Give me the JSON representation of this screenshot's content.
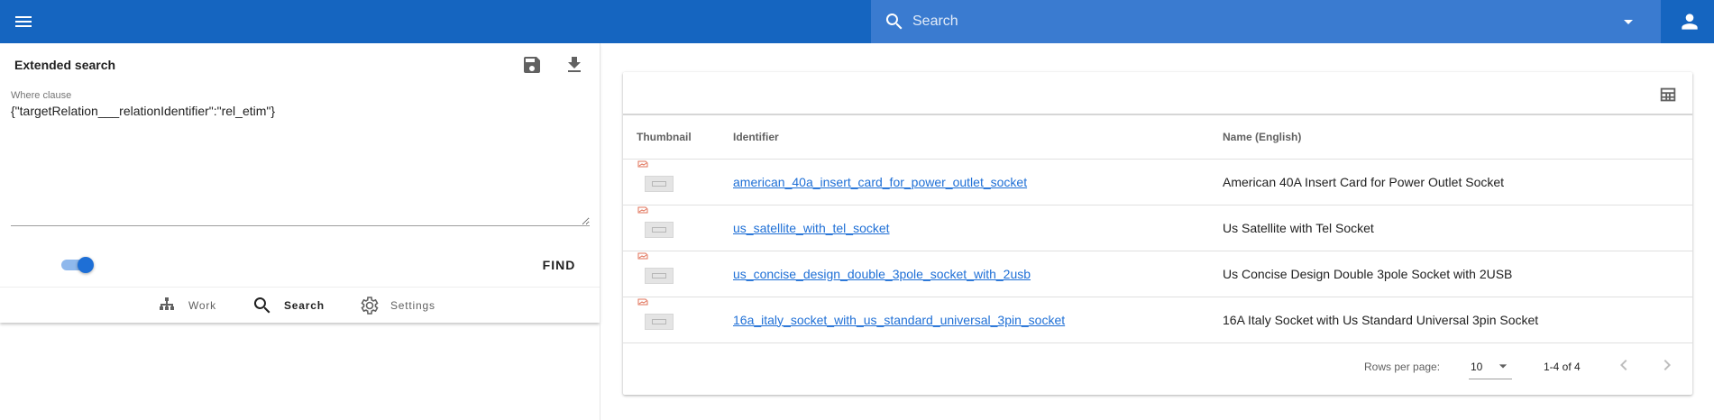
{
  "colors": {
    "appbar": "#1565c0",
    "search_bg": "#3a7bd0",
    "link": "#1e6fd6",
    "toggle_on": "#1e6fd6"
  },
  "appbar": {
    "menu_icon": "hamburger-menu-icon",
    "search": {
      "placeholder": "Search",
      "icon": "search-icon",
      "dropdown_icon": "caret-down-icon"
    },
    "account_icon": "account-icon"
  },
  "extended_search": {
    "title": "Extended search",
    "save_icon": "save-icon",
    "download_icon": "download-icon",
    "where_label": "Where clause",
    "where_value": "{\"targetRelation___relationIdentifier\":\"rel_etim\"}",
    "toggle_on": true,
    "find_label": "FIND"
  },
  "bottom_nav": [
    {
      "label": "Work",
      "icon": "sitemap-icon",
      "active": false
    },
    {
      "label": "Search",
      "icon": "search-icon",
      "active": true
    },
    {
      "label": "Settings",
      "icon": "gear-icon",
      "active": false
    }
  ],
  "results": {
    "columns_icon": "table-columns-icon",
    "headers": [
      "Thumbnail",
      "Identifier",
      "Name (English)"
    ],
    "rows": [
      {
        "identifier": "american_40a_insert_card_for_power_outlet_socket",
        "name": "American 40A Insert Card for Power Outlet Socket"
      },
      {
        "identifier": "us_satellite_with_tel_socket",
        "name": "Us Satellite with Tel Socket"
      },
      {
        "identifier": "us_concise_design_double_3pole_socket_with_2usb",
        "name": "Us Concise Design Double 3pole Socket with 2USB"
      },
      {
        "identifier": "16a_italy_socket_with_us_standard_universal_3pin_socket",
        "name": "16A Italy Socket with Us Standard Universal 3pin Socket"
      }
    ],
    "pagination": {
      "rows_per_page_label": "Rows per page:",
      "rows_per_page": "10",
      "range": "1-4 of 4"
    }
  }
}
